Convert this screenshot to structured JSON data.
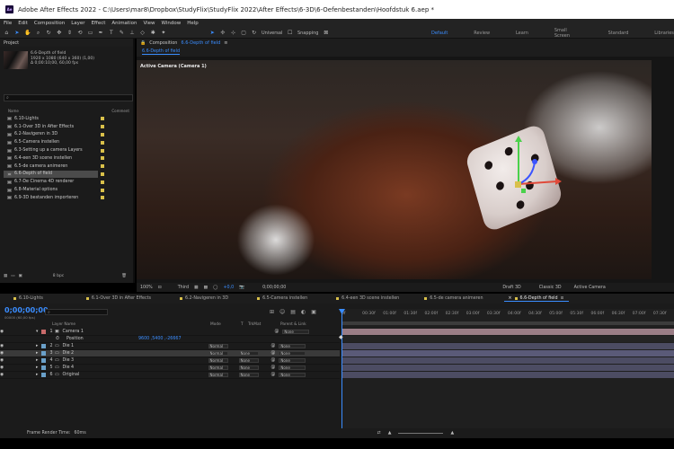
{
  "window": {
    "title": "Adobe After Effects 2022 - C:\\Users\\mar8\\Dropbox\\StudyFlix\\StudyFlix 2022\\After Effects\\6-3D\\6-Oefenbestanden\\Hoofdstuk 6.aep *",
    "app_icon": "Ae"
  },
  "menu": [
    "File",
    "Edit",
    "Composition",
    "Layer",
    "Effect",
    "Animation",
    "View",
    "Window",
    "Help"
  ],
  "toolbar": {
    "universal": "Universal",
    "snapping": "Snapping",
    "workspaces": [
      "Default",
      "Review",
      "Learn",
      "Small Screen",
      "Standard",
      "Libraries"
    ],
    "active_workspace": "Default"
  },
  "project": {
    "panel_label": "Project",
    "selected_name": "6.6-Depth of field",
    "info_lines": [
      "1920 x 1080 (640 x 360) (1,00)",
      "Δ 0;00:10;00, 60,00 fps"
    ],
    "col_name": "Name",
    "col_comment": "Comment",
    "items": [
      "6.10-Lights",
      "6.1-Over 3D in After Effects",
      "6.2-Navigeren in 3D",
      "6.5-Camera instellen",
      "6.3-Setting up a camera Layers",
      "6.4-een 3D scene instellen",
      "6.5-de camera animeren",
      "6.6-Depth of field",
      "6.7-De Cinema 4D renderer",
      "6.8-Material options",
      "6.9-3D bestanden importeren"
    ],
    "selected_index": 7,
    "bpc": "8 bpc"
  },
  "viewer": {
    "tab_label": "Composition",
    "comp_name": "6.6-Depth of field",
    "subtab": "6.6-Depth of field",
    "camera_label": "Active Camera (Camera 1)",
    "zoom": "100%",
    "resolution": "Third",
    "exposure": "+0,0",
    "time": "0;00;00;00",
    "renderer_label": "Draft 3D",
    "renderer": "Classic 3D",
    "view": "Active Camera"
  },
  "comp_tabs": [
    "6.10-Lights",
    "6.1-Over 3D in After Effects",
    "6.2-Navigeren in 3D",
    "6.5-Camera instellen",
    "6.4-een 3D scene instellen",
    "6.5-de camera animeren",
    "6.6-Depth of field"
  ],
  "active_tab_index": 6,
  "timeline": {
    "timecode": "0;00;00;00",
    "fps": "00000 (60,00 fps)",
    "headers": [
      "Layer Name",
      "Mode",
      "T",
      "TrkMat",
      "Parent & Link"
    ],
    "ruler": [
      "0f",
      "00:30f",
      "01:00f",
      "01:30f",
      "02:00f",
      "02:30f",
      "03:00f",
      "03:30f",
      "04:00f",
      "04:30f",
      "05:00f",
      "05:30f",
      "06:00f",
      "06:30f",
      "07:00f",
      "07:30f"
    ],
    "layers": [
      {
        "num": "1",
        "name": "Camera 1",
        "color": "#c96a6a",
        "mode": "",
        "trkmat": "",
        "parent": "None",
        "track_color": "#9a7d86"
      },
      {
        "num": "",
        "name": "Position",
        "color": "",
        "mode": "",
        "trkmat": "",
        "parent": "",
        "value": "9600 ,5400 ,-26667",
        "track_color": "#2a2a2a"
      },
      {
        "num": "2",
        "name": "Die 1",
        "color": "#6aa0c9",
        "mode": "Normal",
        "trkmat": "",
        "parent": "None",
        "track_color": "#4c4c63"
      },
      {
        "num": "3",
        "name": "Die 2",
        "color": "#6aa0c9",
        "mode": "Normal",
        "trkmat": "None",
        "parent": "None",
        "track_color": "#4c4c63"
      },
      {
        "num": "4",
        "name": "Die 3",
        "color": "#6aa0c9",
        "mode": "Normal",
        "trkmat": "None",
        "parent": "None",
        "track_color": "#4c4c63"
      },
      {
        "num": "5",
        "name": "Die 4",
        "color": "#6aa0c9",
        "mode": "Normal",
        "trkmat": "None",
        "parent": "None",
        "track_color": "#4c4c63"
      },
      {
        "num": "6",
        "name": "Original",
        "color": "#6aa0c9",
        "mode": "Normal",
        "trkmat": "None",
        "parent": "None",
        "track_color": "#4c4c63"
      }
    ],
    "selected_layer": 3
  },
  "status": {
    "render_label": "Frame Render Time:",
    "render_value": "60ms"
  }
}
